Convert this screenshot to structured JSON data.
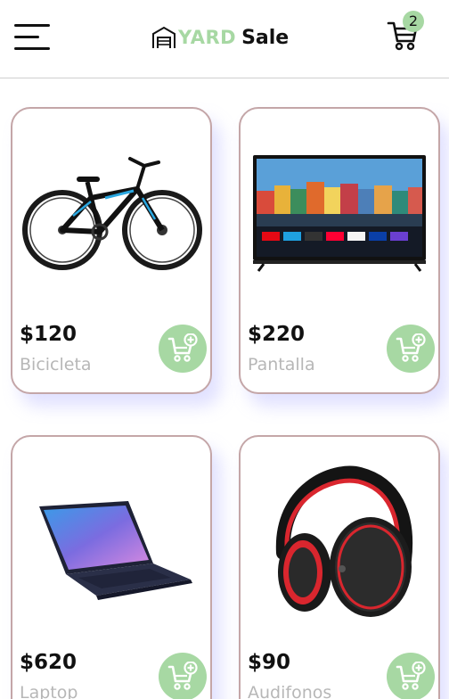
{
  "header": {
    "logo_word": "YARD",
    "logo_sale": "Sale",
    "cart_count": "2"
  },
  "products": [
    {
      "price": "$120",
      "name": "Bicicleta",
      "icon": "bicycle-image"
    },
    {
      "price": "$220",
      "name": "Pantalla",
      "icon": "tv-image"
    },
    {
      "price": "$620",
      "name": "Laptop",
      "icon": "laptop-image"
    },
    {
      "price": "$90",
      "name": "Audifonos",
      "icon": "headphones-image"
    }
  ],
  "colors": {
    "accent": "#a7d8a3",
    "card_border": "#c4a6a8",
    "muted_text": "#b7b7b7"
  }
}
